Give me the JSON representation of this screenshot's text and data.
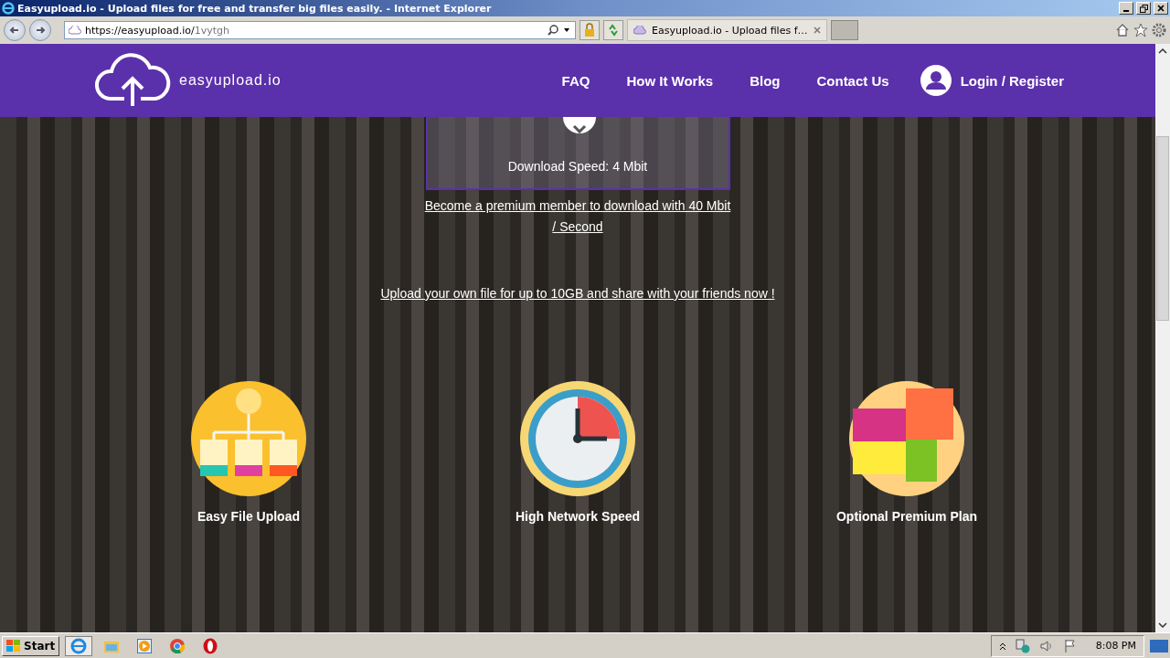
{
  "browser": {
    "title": "Easyupload.io - Upload files for free and transfer big files easily. - Internet Explorer",
    "url_host": "https://easyupload.io/",
    "url_path": "1vytgh",
    "tab_title": "Easyupload.io - Upload files f…"
  },
  "site": {
    "logo_text": "easyupload.io",
    "nav": [
      "FAQ",
      "How It Works",
      "Blog",
      "Contact Us"
    ],
    "login": "Login / Register"
  },
  "download": {
    "speed": "Download Speed: 4 Mbit",
    "premium_link": "Become a premium member to download with 40 Mbit / Second",
    "upload_link": "Upload your own file for up to 10GB and share with your friends now !"
  },
  "features": [
    {
      "kind": "flowchart",
      "label": "Easy File Upload"
    },
    {
      "kind": "clock",
      "label": "High Network Speed"
    },
    {
      "kind": "puzzle",
      "label": "Optional Premium Plan"
    }
  ],
  "taskbar": {
    "start": "Start",
    "clock": "8:08 PM",
    "apps": [
      {
        "kind": "ie",
        "selected": true
      },
      {
        "kind": "folder",
        "selected": false
      },
      {
        "kind": "media",
        "selected": false
      },
      {
        "kind": "chrome",
        "selected": false
      },
      {
        "kind": "opera",
        "selected": false
      }
    ]
  }
}
